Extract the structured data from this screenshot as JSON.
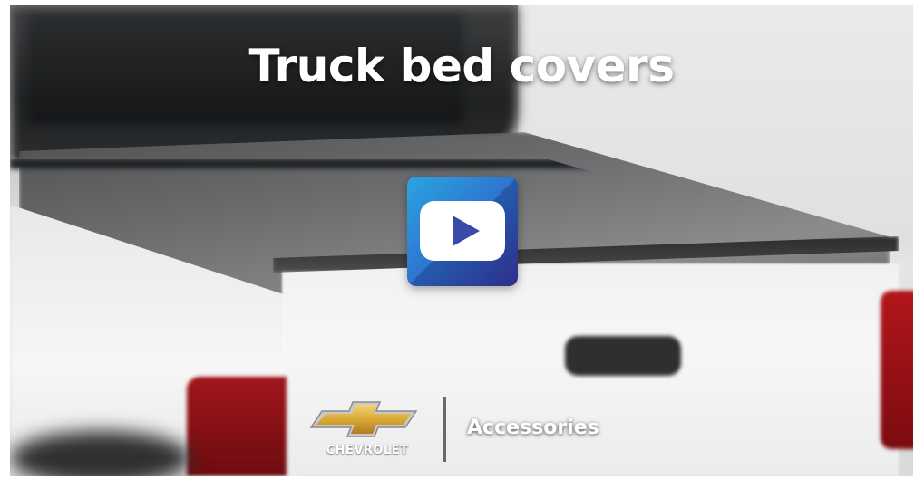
{
  "video": {
    "title": "Truck bed covers",
    "play_icon": "play-icon"
  },
  "brand": {
    "wordmark": "CHEVROLET",
    "logo_icon": "chevrolet-bowtie-icon",
    "tagline": "Accessories"
  },
  "colors": {
    "play_gradient_start": "#2aa6e0",
    "play_gradient_end": "#3b3aa6",
    "bowtie_gold": "#d9a935",
    "title_text": "#ffffff"
  }
}
